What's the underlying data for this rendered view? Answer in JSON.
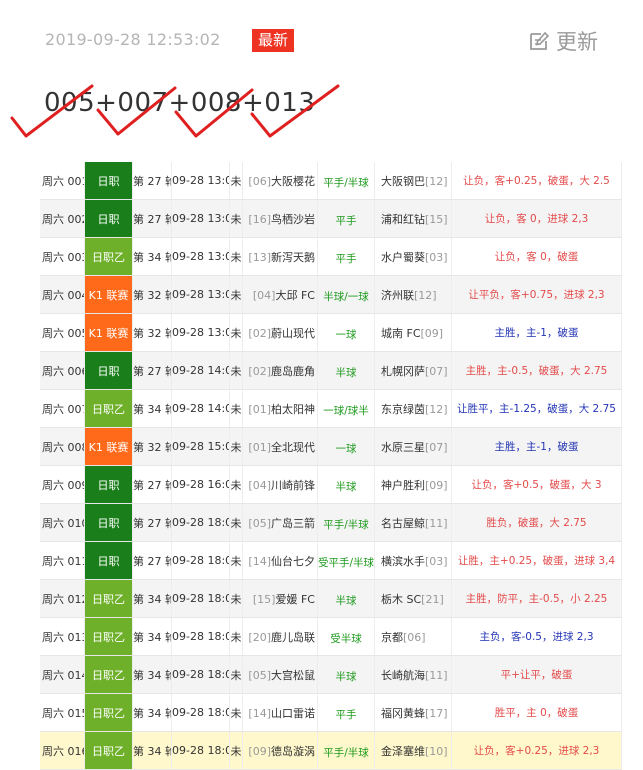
{
  "header": {
    "timestamp": "2019-09-28 12:53:02",
    "badge": "最新",
    "refresh_label": "更新"
  },
  "selection": "005+007+008+013",
  "colors": {
    "league_green": "#1a7f1a",
    "league_lightgreen": "#6fb02a",
    "league_orange": "#ff6a1a",
    "tick_red": "#e02020",
    "handicap_green": "#1d9a1d",
    "result_red": "#e44a4a",
    "result_blue": "#2435b5"
  },
  "rows": [
    {
      "no": "周六 001",
      "league": "日职",
      "lc": "#1a7f1a",
      "round": "第 27 轮",
      "time": "09-28 13:00",
      "status": "未",
      "home_rank": "[06]",
      "home": "大阪樱花",
      "hcp": "平手/半球",
      "away": "大阪钢巴",
      "away_rank": "[12]",
      "result": "让负，客+0.25，破蛋，大 2.5",
      "rc": "red"
    },
    {
      "no": "周六 002",
      "league": "日职",
      "lc": "#1a7f1a",
      "round": "第 27 轮",
      "time": "09-28 13:00",
      "status": "未",
      "home_rank": "[16]",
      "home": "鸟栖沙岩",
      "hcp": "平手",
      "away": "浦和红钻",
      "away_rank": "[15]",
      "result": "让负，客 0，进球 2,3",
      "rc": "red"
    },
    {
      "no": "周六 003",
      "league": "日职乙",
      "lc": "#6fb02a",
      "round": "第 34 轮",
      "time": "09-28 13:00",
      "status": "未",
      "home_rank": "[13]",
      "home": "新泻天鹅",
      "hcp": "平手",
      "away": "水户蜀葵",
      "away_rank": "[03]",
      "result": "让负，客 0，破蛋",
      "rc": "red"
    },
    {
      "no": "周六 004",
      "league": "K1 联赛",
      "lc": "#ff6a1a",
      "round": "第 32 轮",
      "time": "09-28 13:00",
      "status": "未",
      "home_rank": "[04]",
      "home": "大邱 FC",
      "hcp": "半球/一球",
      "away": "济州联",
      "away_rank": "[12]",
      "result": "让平负，客+0.75，进球 2,3",
      "rc": "red"
    },
    {
      "no": "周六 005",
      "league": "K1 联赛",
      "lc": "#ff6a1a",
      "round": "第 32 轮",
      "time": "09-28 13:00",
      "status": "未",
      "home_rank": "[02]",
      "home": "蔚山现代",
      "hcp": "一球",
      "away": "城南 FC",
      "away_rank": "[09]",
      "result": "主胜，主-1，破蛋",
      "rc": "blue"
    },
    {
      "no": "周六 006",
      "league": "日职",
      "lc": "#1a7f1a",
      "round": "第 27 轮",
      "time": "09-28 14:00",
      "status": "未",
      "home_rank": "[02]",
      "home": "鹿岛鹿角",
      "hcp": "半球",
      "away": "札幌冈萨",
      "away_rank": "[07]",
      "result": "主胜，主-0.5，破蛋，大 2.75",
      "rc": "red"
    },
    {
      "no": "周六 007",
      "league": "日职乙",
      "lc": "#6fb02a",
      "round": "第 34 轮",
      "time": "09-28 14:00",
      "status": "未",
      "home_rank": "[01]",
      "home": "柏太阳神",
      "hcp": "一球/球半",
      "away": "东京绿茵",
      "away_rank": "[12]",
      "result": "让胜平，主-1.25，破蛋，大 2.75",
      "rc": "blue"
    },
    {
      "no": "周六 008",
      "league": "K1 联赛",
      "lc": "#ff6a1a",
      "round": "第 32 轮",
      "time": "09-28 15:00",
      "status": "未",
      "home_rank": "[01]",
      "home": "全北现代",
      "hcp": "一球",
      "away": "水原三星",
      "away_rank": "[07]",
      "result": "主胜，主-1，破蛋",
      "rc": "blue"
    },
    {
      "no": "周六 009",
      "league": "日职",
      "lc": "#1a7f1a",
      "round": "第 27 轮",
      "time": "09-28 16:00",
      "status": "未",
      "home_rank": "[04]",
      "home": "川崎前锋",
      "hcp": "半球",
      "away": "神户胜利",
      "away_rank": "[09]",
      "result": "让负，客+0.5，破蛋，大 3",
      "rc": "red"
    },
    {
      "no": "周六 010",
      "league": "日职",
      "lc": "#1a7f1a",
      "round": "第 27 轮",
      "time": "09-28 18:00",
      "status": "未",
      "home_rank": "[05]",
      "home": "广岛三箭",
      "hcp": "平手/半球",
      "away": "名古屋鲸",
      "away_rank": "[11]",
      "result": "胜负，破蛋，大 2.75",
      "rc": "red"
    },
    {
      "no": "周六 011",
      "league": "日职",
      "lc": "#1a7f1a",
      "round": "第 27 轮",
      "time": "09-28 18:00",
      "status": "未",
      "home_rank": "[14]",
      "home": "仙台七夕",
      "hcp": "受平手/半球",
      "away": "横滨水手",
      "away_rank": "[03]",
      "result": "让胜，主+0.25，破蛋，进球 3,4",
      "rc": "red"
    },
    {
      "no": "周六 012",
      "league": "日职乙",
      "lc": "#6fb02a",
      "round": "第 34 轮",
      "time": "09-28 18:00",
      "status": "未",
      "home_rank": "[15]",
      "home": "爱媛 FC",
      "hcp": "半球",
      "away": "栃木 SC",
      "away_rank": "[21]",
      "result": "主胜，防平，主-0.5，小 2.25",
      "rc": "red"
    },
    {
      "no": "周六 013",
      "league": "日职乙",
      "lc": "#6fb02a",
      "round": "第 34 轮",
      "time": "09-28 18:00",
      "status": "未",
      "home_rank": "[20]",
      "home": "鹿儿岛联",
      "hcp": "受半球",
      "away": "京都",
      "away_rank": "[06]",
      "result": "主负，客-0.5，进球 2,3",
      "rc": "blue"
    },
    {
      "no": "周六 014",
      "league": "日职乙",
      "lc": "#6fb02a",
      "round": "第 34 轮",
      "time": "09-28 18:00",
      "status": "未",
      "home_rank": "[05]",
      "home": "大宫松鼠",
      "hcp": "半球",
      "away": "长崎航海",
      "away_rank": "[11]",
      "result": "平+让平，破蛋",
      "rc": "red"
    },
    {
      "no": "周六 015",
      "league": "日职乙",
      "lc": "#6fb02a",
      "round": "第 34 轮",
      "time": "09-28 18:00",
      "status": "未",
      "home_rank": "[14]",
      "home": "山口雷诺",
      "hcp": "平手",
      "away": "福冈黄蜂",
      "away_rank": "[17]",
      "result": "胜平，主 0，破蛋",
      "rc": "red"
    },
    {
      "no": "周六 016",
      "league": "日职乙",
      "lc": "#6fb02a",
      "round": "第 34 轮",
      "time": "09-28 18:00",
      "status": "未",
      "home_rank": "[09]",
      "home": "德岛漩涡",
      "hcp": "平手/半球",
      "away": "金泽塞维",
      "away_rank": "[10]",
      "result": "让负，客+0.25，进球 2,3",
      "rc": "red",
      "hl": true
    }
  ]
}
